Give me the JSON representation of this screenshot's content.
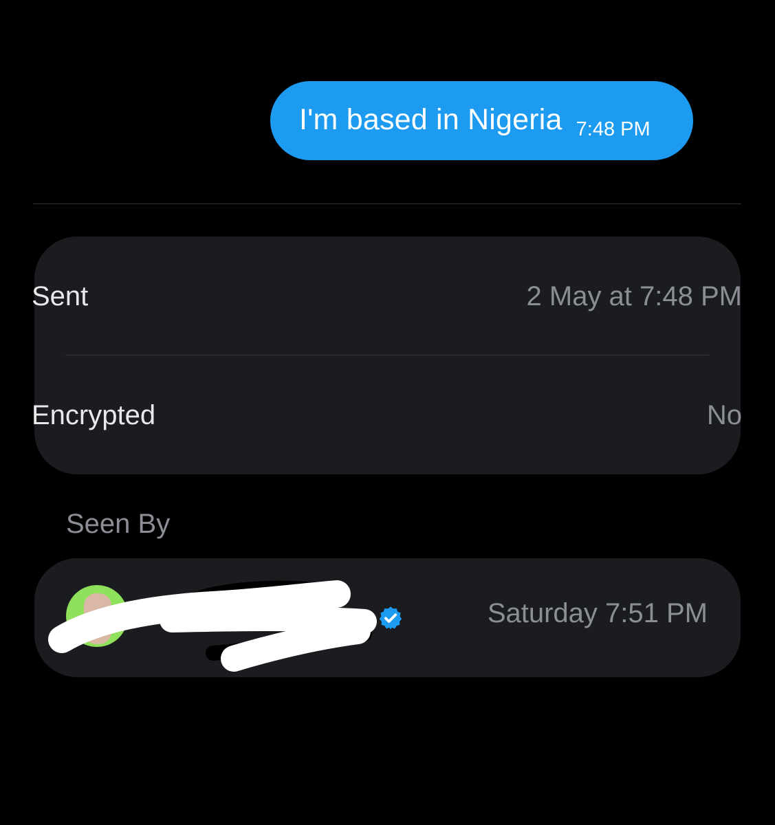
{
  "message": {
    "text": "I'm based in Nigeria",
    "time": "7:48 PM",
    "bubble_color": "#1d9bf0"
  },
  "details": {
    "rows": [
      {
        "label": "Sent",
        "value": "2 May at 7:48 PM"
      },
      {
        "label": "Encrypted",
        "value": "No"
      }
    ]
  },
  "seen_by": {
    "heading": "Seen By",
    "viewers": [
      {
        "name": "",
        "verified": true,
        "time": "Saturday 7:51 PM",
        "icon": "verified-badge-icon"
      }
    ]
  },
  "colors": {
    "background": "#000000",
    "card": "#1b1c20",
    "accent": "#1d9bf0",
    "muted_text": "#8b8f95",
    "primary_text": "#e7e9ea"
  }
}
